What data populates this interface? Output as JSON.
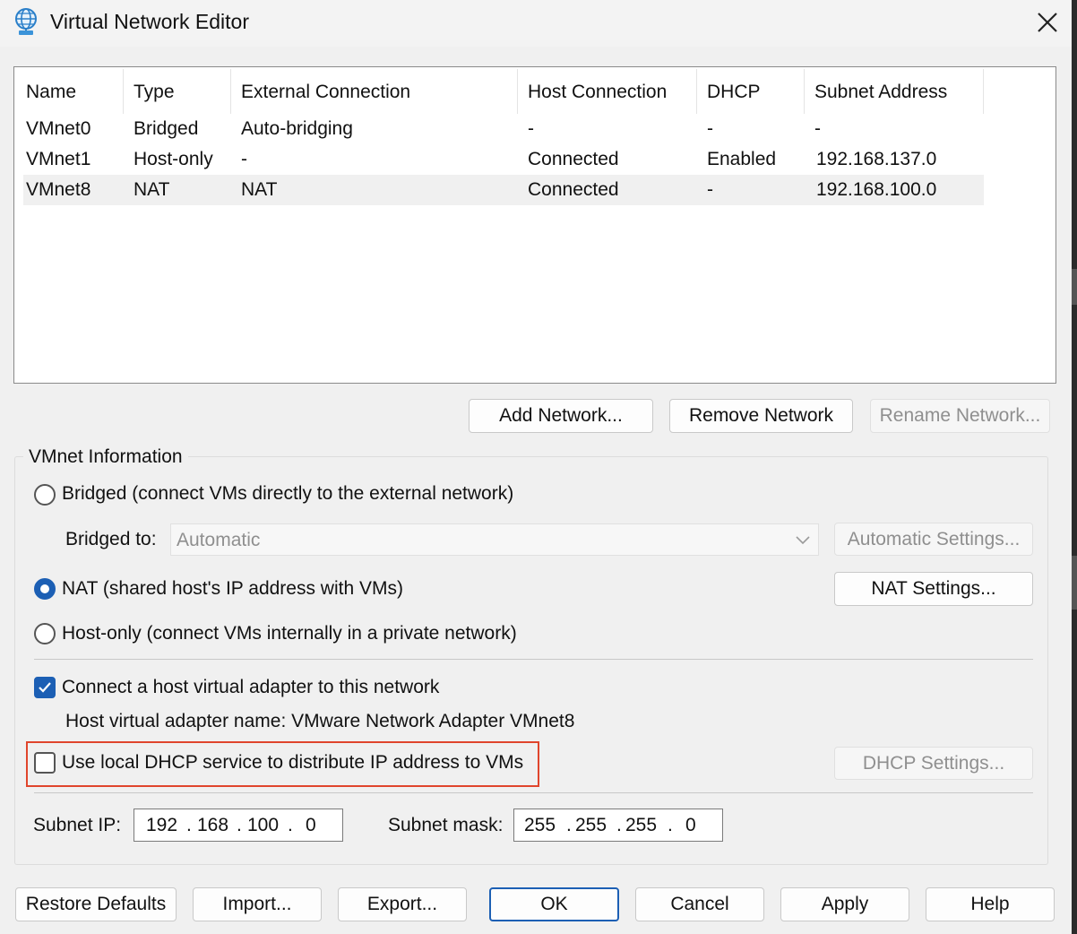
{
  "window": {
    "title": "Virtual Network Editor",
    "icon": "globe-network-icon",
    "close_icon": "close-icon"
  },
  "table": {
    "columns": [
      "Name",
      "Type",
      "External Connection",
      "Host Connection",
      "DHCP",
      "Subnet Address"
    ],
    "rows": [
      [
        "VMnet0",
        "Bridged",
        "Auto-bridging",
        "-",
        "-",
        "-"
      ],
      [
        "VMnet1",
        "Host-only",
        "-",
        "Connected",
        "Enabled",
        "192.168.137.0"
      ],
      [
        "VMnet8",
        "NAT",
        "NAT",
        "Connected",
        "-",
        "192.168.100.0"
      ]
    ],
    "selected_row": 2
  },
  "network_buttons": {
    "add": "Add Network...",
    "remove": "Remove Network",
    "rename": "Rename Network..."
  },
  "vmnet_info": {
    "legend": "VMnet Information",
    "bridged_label": "Bridged (connect VMs directly to the external network)",
    "bridged_to_label": "Bridged to:",
    "bridged_to_value": "Automatic",
    "automatic_settings": "Automatic Settings...",
    "nat_label": "NAT (shared host's IP address with VMs)",
    "nat_settings": "NAT Settings...",
    "hostonly_label": "Host-only (connect VMs internally in a private network)",
    "selected_mode": "NAT",
    "connect_adapter_label": "Connect a host virtual adapter to this network",
    "connect_adapter_checked": true,
    "adapter_name_text": "Host virtual adapter name: VMware Network Adapter VMnet8",
    "dhcp_label": "Use local DHCP service to distribute IP address to VMs",
    "dhcp_checked": false,
    "dhcp_settings": "DHCP Settings...",
    "subnet_ip_label": "Subnet IP:",
    "subnet_ip": [
      "192",
      "168",
      "100",
      "0"
    ],
    "subnet_mask_label": "Subnet mask:",
    "subnet_mask": [
      "255",
      "255",
      "255",
      "0"
    ],
    "ip_separator": "."
  },
  "footer": {
    "restore": "Restore Defaults",
    "import": "Import...",
    "export": "Export...",
    "ok": "OK",
    "cancel": "Cancel",
    "apply": "Apply",
    "help": "Help"
  },
  "colors": {
    "accent": "#1c5fb4",
    "highlight_box": "#e0452c"
  }
}
